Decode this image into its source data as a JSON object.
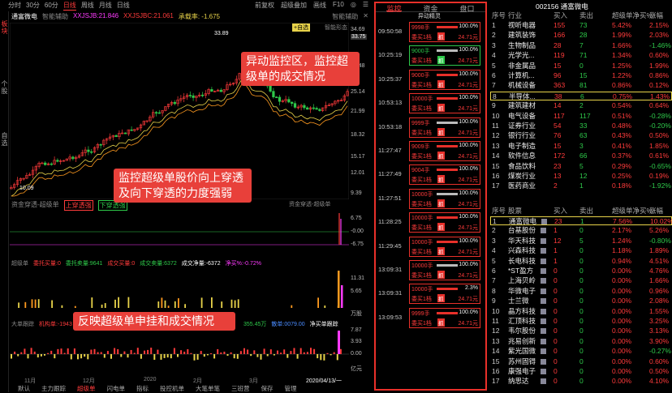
{
  "toolbar": {
    "timeframes": [
      "分时",
      "30分",
      "60分",
      "日线",
      "周线",
      "月线",
      "日线"
    ],
    "active": "日线",
    "right": [
      "前复权",
      "超级叠加",
      "画线",
      "F10",
      "◎",
      "☰"
    ]
  },
  "left_tabs": [
    "板块",
    "个股",
    "自选"
  ],
  "stock": {
    "name": "通富微电",
    "indicator": "智能辅助",
    "ma1": "XXJSJB:21.846",
    "ma2": "XXJSJBC:21.061",
    "extra": "承载率: -1.675",
    "add_fav": "+自选",
    "assist": "智能辅助",
    "cross": "智能形态"
  },
  "price_axis": [
    "34.69",
    "33.75",
    "29.48",
    "25.14",
    "21.99",
    "18.32",
    "15.17",
    "12.01",
    "9.39"
  ],
  "price_labels": {
    "high": "33.89",
    "low": "10.09"
  },
  "panel1": {
    "title": "资金穿透-超级单",
    "items": [
      {
        "label": "上穿透强",
        "color": "#ff3b3b"
      },
      {
        "label": "下穿透强",
        "color": "#2ec94a"
      }
    ],
    "right_label": "资金穿透-超级单",
    "axis": [
      "6.75",
      "-0.00",
      "-6.75"
    ]
  },
  "panel2": {
    "title": "超级单",
    "items": [
      {
        "label": "委托买量:0",
        "color": "#ff3b3b"
      },
      {
        "label": "委托卖量:9641",
        "color": "#2ec94a"
      },
      {
        "label": "成交买量:0",
        "color": "#ff3b3b"
      },
      {
        "label": "成交卖量:6372",
        "color": "#2ec94a"
      },
      {
        "label": "成交净量:-6372",
        "color": "#fff"
      },
      {
        "label": "净买%:-0.72%",
        "color": "#ff3bff"
      }
    ],
    "axis": [
      "11.31",
      "5.65",
      "万股"
    ]
  },
  "panel3": {
    "title": "大单跟踪",
    "items": [
      {
        "label": "机构单:-1943",
        "color": "#ff3b3b"
      },
      {
        "label": "355.45万",
        "color": "#2ec94a"
      },
      {
        "label": "散单:0079.00",
        "color": "#2ec94a"
      },
      {
        "label": "净买单跟踪",
        "color": "#fff"
      }
    ],
    "axis": [
      "7.87",
      "3.93",
      "0.00",
      "亿元"
    ]
  },
  "dates": [
    "11月",
    "12月",
    "2020",
    "2月",
    "3月",
    "2020/04/13/一"
  ],
  "bottom_tabs": [
    "默认",
    "主力跟踪",
    "超级单",
    "闪电单",
    "指标",
    "投控机单",
    "大笔单笔",
    "三班营",
    "保存",
    "管理"
  ],
  "bottom_active": "超级单",
  "callouts": {
    "monitor": "异动监控区，监控超级单的成交情况",
    "cross": "监控超级单股价向上穿透及向下穿透的力度强弱",
    "bid": "反映超级单申挂和成交情况"
  },
  "monitor": {
    "tabs": [
      "监控",
      "资金",
      "盘口"
    ],
    "active": "监控",
    "subtitle": "异动精灵",
    "rows": [
      {
        "time": "09:50:58",
        "vol": "9998手",
        "type": "委买1档",
        "pct": "100.0%",
        "price": "24.71元",
        "badge": "抓",
        "green": false
      },
      {
        "time": "10:25:19",
        "vol": "9000手",
        "type": "委买1档",
        "pct": "100.0%",
        "price": "24.71元",
        "badge": "抓",
        "green": true
      },
      {
        "time": "10:25:37",
        "vol": "9000手",
        "type": "委买1档",
        "pct": "100.0%",
        "price": "24.71元",
        "badge": "抓",
        "green": false
      },
      {
        "time": "10:53:13",
        "vol": "10000手",
        "type": "委买1档",
        "pct": "100.0%",
        "price": "24.71元",
        "badge": "抓",
        "green": false
      },
      {
        "time": "10:53:18",
        "vol": "9999手",
        "type": "委买1档",
        "pct": "100.0%",
        "price": "24.71元",
        "badge": "抓",
        "green": false
      },
      {
        "time": "11:27:47",
        "vol": "9009手",
        "type": "委买1档",
        "pct": "100.0%",
        "price": "24.71元",
        "badge": "抓",
        "green": false
      },
      {
        "time": "11:27:49",
        "vol": "9004手",
        "type": "委买1档",
        "pct": "100.0%",
        "price": "24.71元",
        "badge": "抓",
        "green": false
      },
      {
        "time": "11:27:51",
        "vol": "10000手",
        "type": "委买1档",
        "pct": "100.0%",
        "price": "24.71元",
        "badge": "抓",
        "green": false
      },
      {
        "time": "11:28:25",
        "vol": "10000手",
        "type": "委买1档",
        "pct": "100.0%",
        "price": "24.71元",
        "badge": "抓",
        "green": false
      },
      {
        "time": "11:29:45",
        "vol": "10000手",
        "type": "委买1档",
        "pct": "100.0%",
        "price": "24.71元",
        "badge": "抓",
        "green": false
      },
      {
        "time": "13:09:31",
        "vol": "10000手",
        "type": "委买1档",
        "pct": "100.0%",
        "price": "24.71元",
        "badge": "抓",
        "green": false
      },
      {
        "time": "13:09:31",
        "vol": "10000手",
        "type": "委买1档",
        "pct": "2.3%",
        "price": "24.71元",
        "badge": "抓",
        "green": false
      },
      {
        "time": "13:09:53",
        "vol": "9999手",
        "type": "委买1档",
        "pct": "100.0%",
        "price": "24.71元",
        "badge": "抓",
        "green": false
      }
    ]
  },
  "sector_table": {
    "headers": [
      "序号",
      "行业",
      "买入",
      "卖出",
      "超级单净买%",
      "涨幅"
    ],
    "rows": [
      [
        "1",
        "视听电器",
        "155",
        "73",
        "5.42%",
        "2.15%"
      ],
      [
        "2",
        "建筑装饰",
        "166",
        "28",
        "1.99%",
        "2.03%"
      ],
      [
        "3",
        "生物制品",
        "28",
        "7",
        "1.66%",
        "-1.46%"
      ],
      [
        "4",
        "光学光...",
        "119",
        "71",
        "1.34%",
        "0.60%"
      ],
      [
        "5",
        "非金属品",
        "15",
        "0",
        "1.25%",
        "1.99%"
      ],
      [
        "6",
        "计算机...",
        "96",
        "15",
        "1.22%",
        "0.86%"
      ],
      [
        "7",
        "机械设备",
        "363",
        "81",
        "0.86%",
        "0.12%"
      ],
      [
        "8",
        "半导体...",
        "38",
        "6",
        "0.75%",
        "1.43%"
      ],
      [
        "9",
        "建筑建材",
        "14",
        "2",
        "0.54%",
        "0.64%"
      ],
      [
        "10",
        "电气设备",
        "117",
        "117",
        "0.51%",
        "-0.28%"
      ],
      [
        "11",
        "证券行业",
        "54",
        "33",
        "0.48%",
        "-0.20%"
      ],
      [
        "12",
        "银行行业",
        "76",
        "63",
        "0.43%",
        "0.50%"
      ],
      [
        "13",
        "电子制造",
        "15",
        "3",
        "0.41%",
        "1.85%"
      ],
      [
        "14",
        "软件信息",
        "172",
        "66",
        "0.37%",
        "0.61%"
      ],
      [
        "15",
        "食品饮料",
        "23",
        "5",
        "0.29%",
        "-0.65%"
      ],
      [
        "16",
        "煤炭行业",
        "13",
        "12",
        "0.25%",
        "0.19%"
      ],
      [
        "17",
        "医药商业",
        "2",
        "1",
        "0.18%",
        "-1.92%"
      ]
    ]
  },
  "stock_title": "002156 通富微电",
  "stock_table": {
    "headers": [
      "序号",
      "股票",
      "买入",
      "卖出",
      "超级单净买%",
      "涨幅"
    ],
    "rows": [
      [
        "1",
        "通富微电",
        "23",
        "1",
        "7.56%",
        "10.02%"
      ],
      [
        "2",
        "台基股份",
        "1",
        "0",
        "2.17%",
        "5.26%"
      ],
      [
        "3",
        "华天科技",
        "12",
        "5",
        "1.24%",
        "-0.80%"
      ],
      [
        "4",
        "兴森科技",
        "1",
        "0",
        "1.18%",
        "1.89%"
      ],
      [
        "5",
        "长电科技",
        "1",
        "0",
        "0.94%",
        "4.51%"
      ],
      [
        "6",
        "*ST盈方",
        "0",
        "0",
        "0.00%",
        "4.76%"
      ],
      [
        "7",
        "上海贝岭",
        "0",
        "0",
        "0.00%",
        "1.66%"
      ],
      [
        "8",
        "华微电子",
        "0",
        "0",
        "0.00%",
        "0.96%"
      ],
      [
        "9",
        "士兰微",
        "0",
        "0",
        "0.00%",
        "2.08%"
      ],
      [
        "10",
        "晶方科技",
        "0",
        "0",
        "0.00%",
        "1.55%"
      ],
      [
        "11",
        "汇顶科技",
        "0",
        "0",
        "0.00%",
        "3.25%"
      ],
      [
        "12",
        "韦尔股份",
        "0",
        "0",
        "0.00%",
        "3.13%"
      ],
      [
        "13",
        "兆易创新",
        "0",
        "0",
        "0.00%",
        "3.90%"
      ],
      [
        "14",
        "紫光国微",
        "0",
        "0",
        "0.00%",
        "-0.27%"
      ],
      [
        "15",
        "苏州固锝",
        "0",
        "0",
        "0.00%",
        "0.60%"
      ],
      [
        "16",
        "康强电子",
        "0",
        "0",
        "0.00%",
        "0.50%"
      ],
      [
        "17",
        "纳思达",
        "0",
        "0",
        "0.00%",
        "4.10%"
      ]
    ]
  }
}
